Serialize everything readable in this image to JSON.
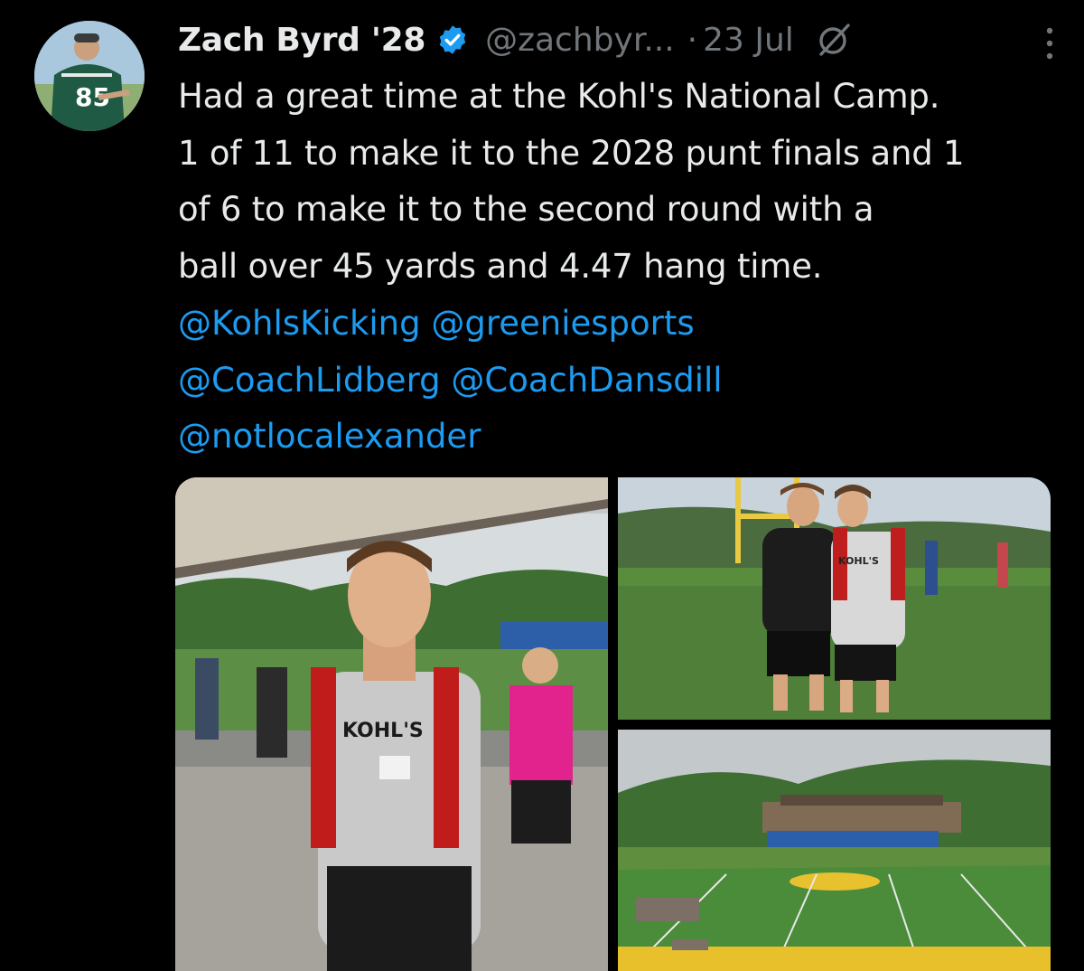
{
  "author": {
    "display_name": "Zach Byrd '28",
    "handle": "@zachbyr...",
    "separator": "·",
    "date": "23 Jul",
    "verified": true,
    "avatar_jersey_number": "85"
  },
  "tweet": {
    "lines": [
      "Had a great time at the Kohl's National Camp.",
      "1 of 11 to make it to the 2028 punt finals and 1",
      "of 6 to make it to the second round with a",
      "ball over 45 yards and 4.47 hang time."
    ],
    "mentions": {
      "m1": "@KohlsKicking",
      "m2": "@greeniesports",
      "m3": "@CoachLidberg",
      "m4": "@CoachDansdill",
      "m5": "@notlocalexander"
    }
  },
  "media": {
    "photo1_shirt_text": "KOHL'S",
    "photo2_shirt_text": "KOHL'S"
  },
  "icons": {
    "verified": "verified-badge-icon",
    "grok": "grok-icon",
    "more": "more-options-icon"
  },
  "colors": {
    "background": "#000000",
    "text": "#e7e9ea",
    "secondary": "#71767b",
    "link": "#1d9bf0",
    "verified": "#1d9bf0"
  }
}
